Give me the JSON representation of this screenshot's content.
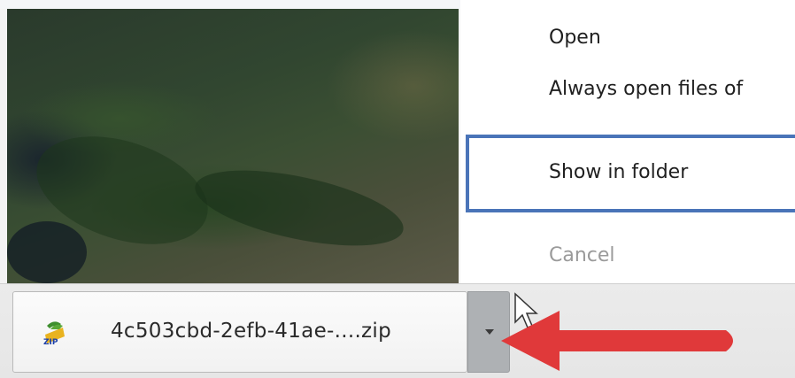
{
  "context_menu": {
    "items": [
      {
        "label": "Open"
      },
      {
        "label": "Always open files of"
      },
      {
        "label": "Show in folder"
      },
      {
        "label": "Cancel"
      }
    ],
    "highlight_color": "#4a74b8",
    "disabled_color": "#9a9a9a"
  },
  "download_bar": {
    "file_name": "4c503cbd-2efb-41ae-....zip",
    "file_icon": "zip-file-icon",
    "dropdown_icon": "chevron-down-icon"
  },
  "annotation": {
    "arrow_color": "#e0393a",
    "arrow_icon": "red-arrow-annotation"
  },
  "cursor_icon": "mouse-pointer-icon"
}
